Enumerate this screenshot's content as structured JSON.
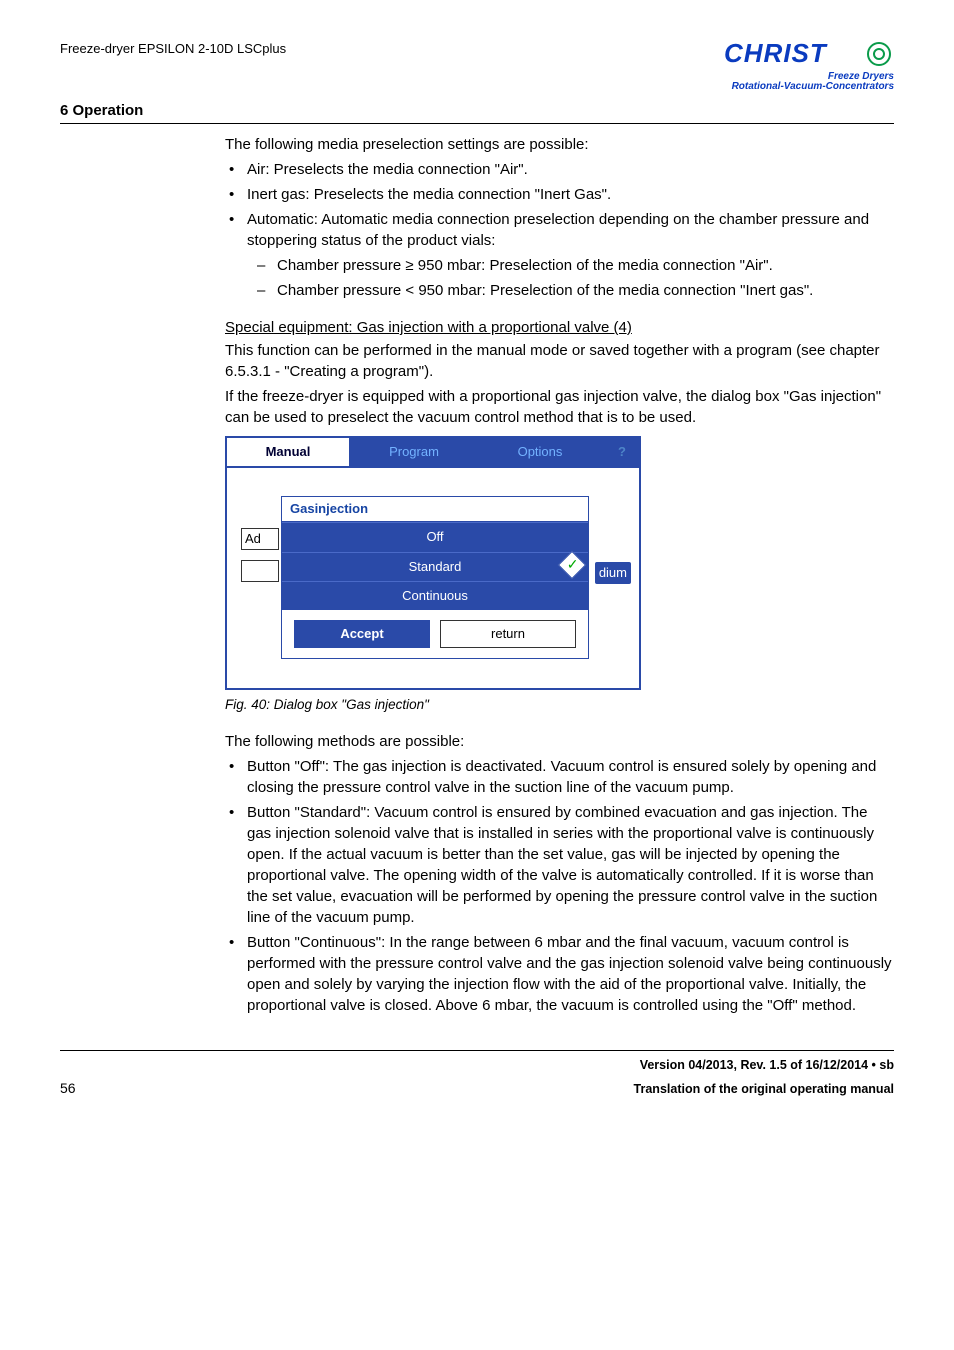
{
  "header": {
    "doc_label": "Freeze-dryer EPSILON 2-10D LSCplus",
    "logo_text": "CHRIST",
    "logo_sub1": "Freeze Dryers",
    "logo_sub2": "Rotational-Vacuum-Concentrators",
    "section_title": "6 Operation"
  },
  "body": {
    "intro": "The following media preselection settings are possible:",
    "media_list": {
      "air": "Air: Preselects the media connection \"Air\".",
      "inert": "Inert gas: Preselects the media connection \"Inert Gas\".",
      "auto_lead": "Automatic: Automatic media connection preselection depending on the chamber pressure and stoppering status of the product vials:",
      "auto_sub": {
        "a": "Chamber pressure ≥ 950 mbar: Preselection of the media connection \"Air\".",
        "b": "Chamber pressure < 950 mbar: Preselection of the media connection \"Inert gas\"."
      }
    },
    "special_heading": "Special equipment: Gas injection with a proportional valve (4)",
    "special_p1": "This function can be performed in the manual mode or saved together with a program (see chapter 6.5.3.1 - \"Creating a program\").",
    "special_p2": "If the freeze-dryer is equipped with a proportional gas injection valve, the dialog box \"Gas injection\" can be used to preselect the vacuum control method that is to be used.",
    "dialog": {
      "tabs": {
        "manual": "Manual",
        "program": "Program",
        "options": "Options",
        "help": "?"
      },
      "side_label": "Ad",
      "right_label": "dium",
      "panel_title": "Gasinjection",
      "options": {
        "off": "Off",
        "standard": "Standard",
        "continuous": "Continuous"
      },
      "buttons": {
        "accept": "Accept",
        "return": "return"
      }
    },
    "fig_caption": "Fig. 40: Dialog box \"Gas injection\"",
    "methods_intro": "The following methods are possible:",
    "methods": {
      "off": "Button \"Off\": The gas injection is deactivated. Vacuum control is ensured solely by opening and closing the pressure control valve in the suction line of the vacuum pump.",
      "standard": "Button \"Standard\": Vacuum control is ensured by combined evacuation and gas injection. The gas injection solenoid valve that is installed in series with the proportional valve is continuously open. If the actual vacuum is better than the set value, gas will be injected by opening the proportional valve. The opening width of the valve is automatically controlled. If it is worse than the set value, evacuation will be performed by opening the pressure control valve in the suction line of the vacuum pump.",
      "continuous": "Button \"Continuous\": In the range between 6 mbar and the final vacuum, vacuum control is performed with the pressure control valve and the gas injection solenoid valve being continuously open and solely by varying the injection flow with the aid of the proportional valve. Initially, the proportional valve is closed. Above 6 mbar, the vacuum is controlled using the \"Off\" method."
    }
  },
  "footer": {
    "version": "Version 04/2013, Rev. 1.5 of 16/12/2014 • sb",
    "translation": "Translation of the original operating manual",
    "page": "56"
  }
}
